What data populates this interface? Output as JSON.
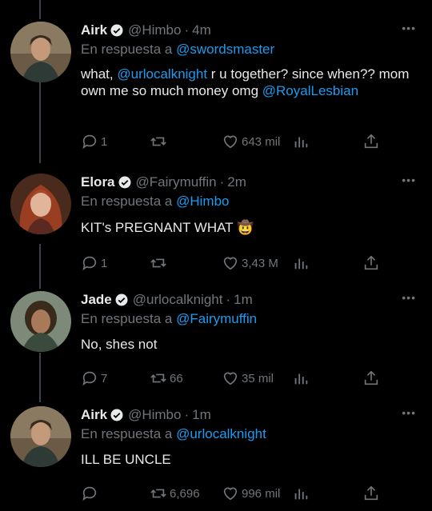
{
  "tweets": [
    {
      "name": "Airk",
      "handle": "@Himbo",
      "time": "4m",
      "reply_prefix": "En respuesta a",
      "reply_to": "@swordsmaster",
      "text_parts": [
        "what, ",
        "@urlocalknight",
        " r u together? since when?? mom own me so much money omg ",
        "@RoyalLesbian"
      ],
      "replies": "1",
      "retweets": "",
      "likes": "643 mil"
    },
    {
      "name": "Elora",
      "handle": "@Fairymuffin",
      "time": "2m",
      "reply_prefix": "En respuesta a",
      "reply_to": "@Himbo",
      "text": "KIT's PREGNANT WHAT 🤠",
      "replies": "1",
      "retweets": "",
      "likes": "3,43 M"
    },
    {
      "name": "Jade",
      "handle": "@urlocalknight",
      "time": "1m",
      "reply_prefix": "En respuesta a",
      "reply_to": "@Fairymuffin",
      "text": "No, shes not",
      "replies": "7",
      "retweets": "66",
      "likes": "35 mil"
    },
    {
      "name": "Airk",
      "handle": "@Himbo",
      "time": "1m",
      "reply_prefix": "En respuesta a",
      "reply_to": "@urlocalknight",
      "text": "ILL BE UNCLE",
      "replies": "",
      "retweets": "6,696",
      "likes": "996 mil"
    }
  ],
  "colors": {
    "accent": "#1d9bf0",
    "muted": "#71767b",
    "text": "#e7e9ea",
    "background": "#000000"
  },
  "icons": [
    "verified-icon",
    "more-icon",
    "reply-icon",
    "retweet-icon",
    "like-icon",
    "stats-icon",
    "share-icon"
  ]
}
